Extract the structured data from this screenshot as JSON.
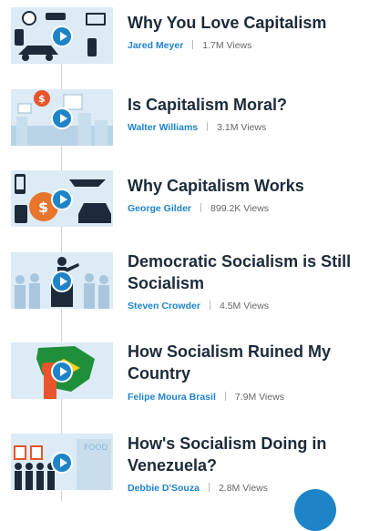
{
  "videos": [
    {
      "title": "Why You Love Capitalism",
      "author": "Jared Meyer",
      "views": "1.7M Views"
    },
    {
      "title": "Is Capitalism Moral?",
      "author": "Walter Williams",
      "views": "3.1M Views"
    },
    {
      "title": "Why Capitalism Works",
      "author": "George Gilder",
      "views": "899.2K Views"
    },
    {
      "title": "Democratic Socialism is Still Socialism",
      "author": "Steven Crowder",
      "views": "4.5M Views"
    },
    {
      "title": "How Socialism Ruined My Country",
      "author": "Felipe Moura Brasil",
      "views": "7.9M Views"
    },
    {
      "title": "How's Socialism Doing in Venezuela?",
      "author": "Debbie D'Souza",
      "views": "2.8M Views"
    }
  ],
  "thumbnails": {
    "3": {
      "sign_text": "FOOD"
    }
  },
  "icons": [
    "play-icon"
  ],
  "colors": {
    "accent": "#1e84c8",
    "title": "#1c2a39",
    "thumb_bg": "#dcebf5"
  }
}
